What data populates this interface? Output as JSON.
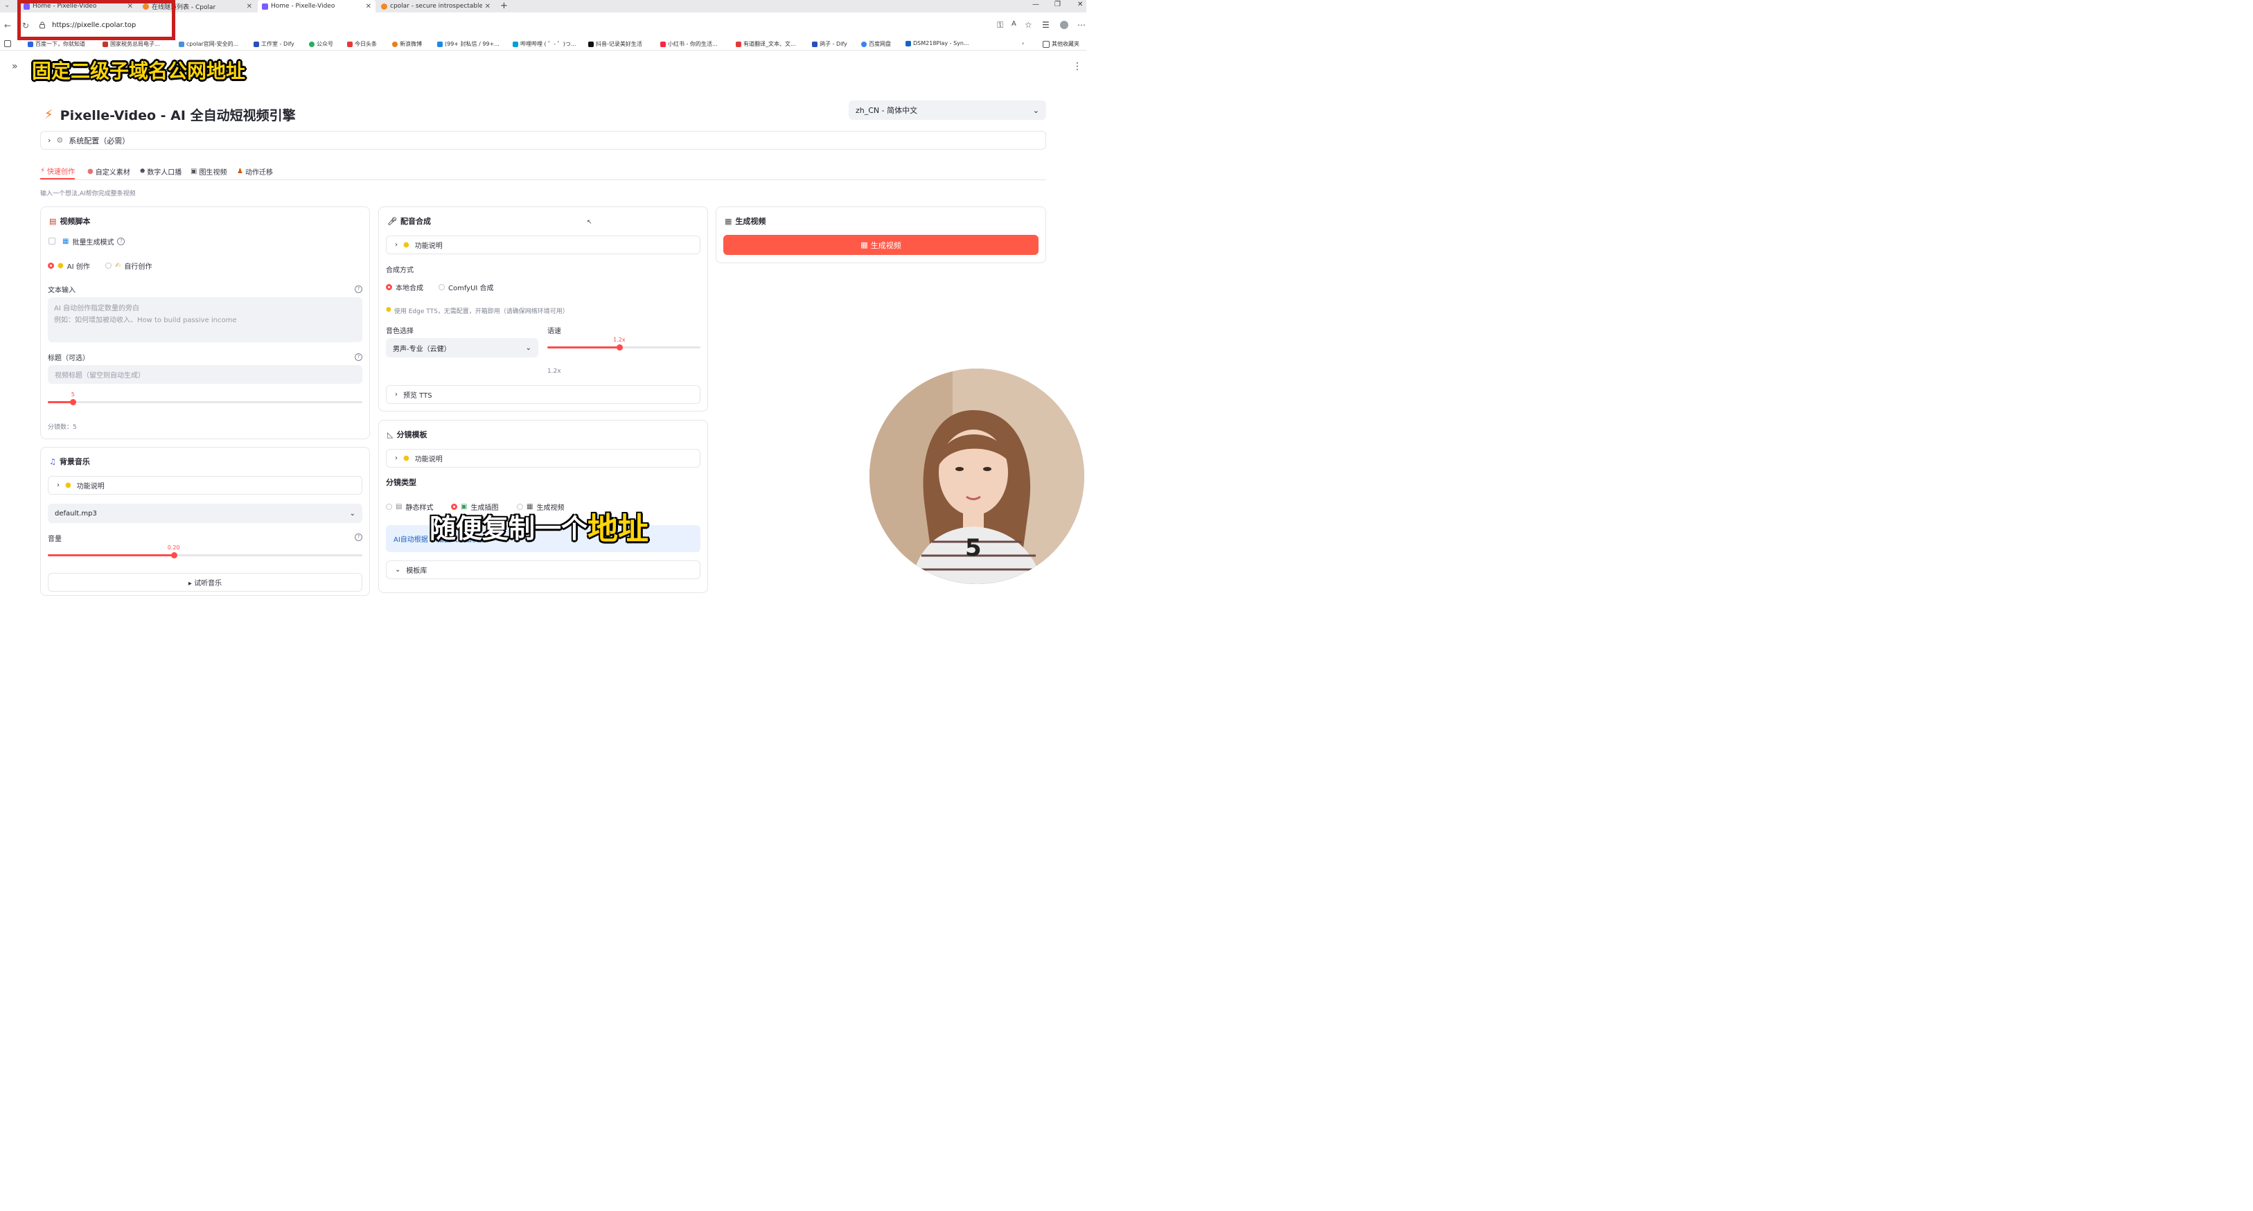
{
  "browser": {
    "tabs": [
      {
        "title": "Home - Pixelle-Video",
        "color": "#7c5cff"
      },
      {
        "title": "在线隧道列表 - Cpolar",
        "color": "#f08a24"
      },
      {
        "title": "Home - Pixelle-Video",
        "color": "#7c5cff"
      },
      {
        "title": "cpolar - secure introspectable tunn",
        "color": "#f08a24"
      }
    ],
    "url": "https://pixelle.cpolar.top",
    "bookmarks": [
      "百度一下，你就知道",
      "国家税务总局电子...",
      "cpolar官网-安全的...",
      "工作室 - Dify",
      "公众号",
      "今日头条",
      "新浪微博",
      "(99+ 封私信 / 99+...",
      "哔哩哔哩 ( ゜- ゜)つ...",
      "抖音-记录美好生活",
      "小红书 - 你的生活...",
      "有道翻译_文本、文...",
      "鸽子 - Dify",
      "百度网盘",
      "DSM218Play - Syn...",
      "其他收藏夹"
    ]
  },
  "overlay": {
    "title": "固定二级子域名公网地址",
    "subtitle_white": "随便复制一个",
    "subtitle_yellow": "地址"
  },
  "app": {
    "title": "Pixelle-Video - AI 全自动短视频引擎",
    "language": "zh_CN - 简体中文",
    "sysconfig": "系统配置（必需）",
    "tabs": [
      "快速创作",
      "自定义素材",
      "数字人口播",
      "图生视频",
      "动作迁移"
    ],
    "subtitle": "输入一个想法,AI帮你完成整条视频"
  },
  "script_panel": {
    "title": "视频脚本",
    "batch_mode": "批量生成模式",
    "mode_ai": "AI 创作",
    "mode_self": "自行创作",
    "text_input_label": "文本输入",
    "text_placeholder_1": "AI 自动创作指定数量的旁白",
    "text_placeholder_2": "例如：如何增加被动收入、How to build passive income",
    "title_label": "标题（可选）",
    "title_placeholder": "视频标题（留空则自动生成）",
    "scenes_value": "5",
    "scenes_fraction": 0.08,
    "scenes_label": "分镜数：5"
  },
  "bgm_panel": {
    "title": "背景音乐",
    "func_desc": "功能说明",
    "track": "default.mp3",
    "volume_label": "音量",
    "volume_value": "0.20",
    "volume_fraction": 0.4,
    "preview": "▸ 试听音乐"
  },
  "tts_panel": {
    "title": "配音合成",
    "func_desc": "功能说明",
    "method_label": "合成方式",
    "method_local": "本地合成",
    "method_comfy": "ComfyUI 合成",
    "hint": "使用 Edge TTS，无需配置，开箱即用（请确保网络环境可用）",
    "voice_label": "音色选择",
    "voice_value": "男声-专业（云健）",
    "speed_label": "语速",
    "speed_value": "1.2x",
    "speed_fraction": 0.47,
    "speed_below": "1.2x",
    "preview": "预览 TTS"
  },
  "storyboard_panel": {
    "title": "分镜模板",
    "func_desc": "功能说明",
    "type_label": "分镜类型",
    "type_static": "静态样式",
    "type_image": "生成插图",
    "type_video": "生成视频",
    "info": "AI自动根据         ，插图尺寸由模板",
    "library": "模板库"
  },
  "gen_panel": {
    "title": "生成视频",
    "button": "生成视频"
  },
  "colors": {
    "accent": "#ff4b4b",
    "button": "#ff5a48",
    "overlay_yellow": "#ffd60a",
    "info_blue": "#1c62c7"
  }
}
